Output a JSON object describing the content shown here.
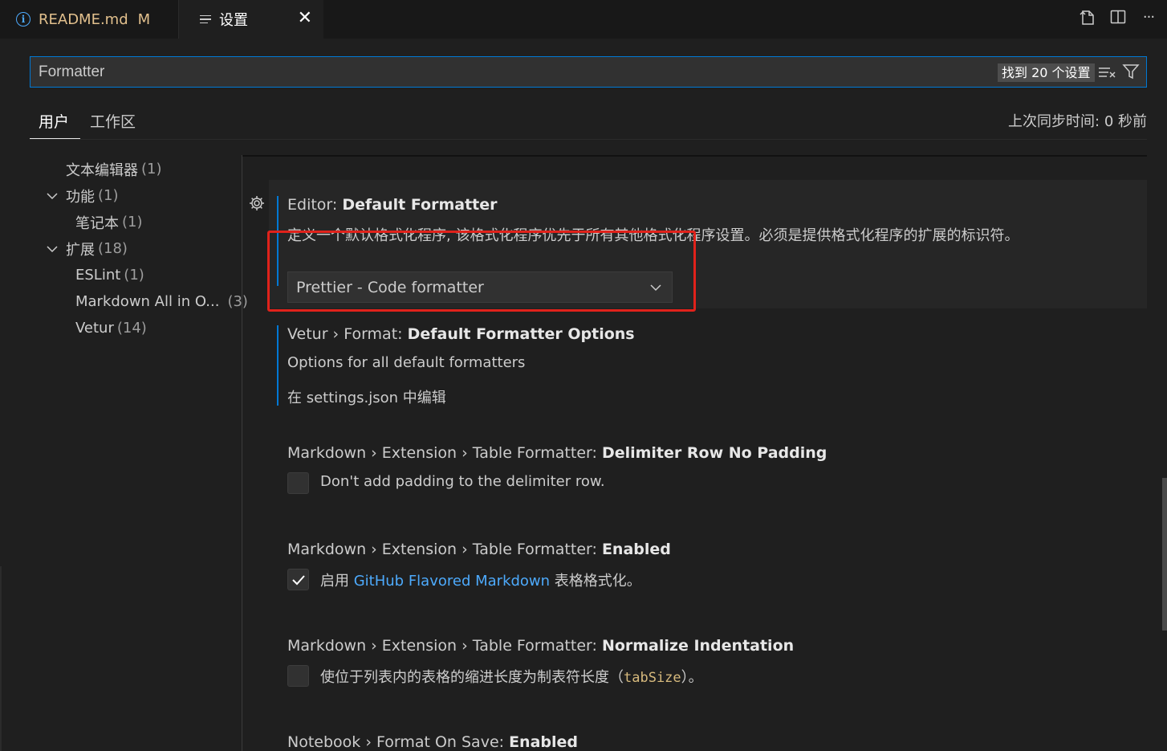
{
  "tabs": {
    "readme": {
      "label": "README.md",
      "badge": "M"
    },
    "settings": {
      "label": "设置",
      "close": "✕"
    }
  },
  "toolbar": {
    "open_json_icon": "open-settings-json-icon",
    "split_icon": "split-editor-icon",
    "more_label": "···"
  },
  "search": {
    "value": "Formatter",
    "count": "找到 20 个设置"
  },
  "scope": {
    "user": "用户",
    "workspace": "工作区",
    "sync": "上次同步时间: 0 秒前"
  },
  "toc": [
    {
      "label": "文本编辑器",
      "count": "(1)"
    },
    {
      "label": "功能",
      "count": "(1)"
    },
    {
      "label": "笔记本",
      "count": "(1)"
    },
    {
      "label": "扩展",
      "count": "(18)"
    },
    {
      "label": "ESLint",
      "count": "(1)"
    },
    {
      "label": "Markdown All in O...",
      "count": "(3)"
    },
    {
      "label": "Vetur",
      "count": "(14)"
    }
  ],
  "settings": {
    "default_formatter": {
      "category": "Editor: ",
      "name": "Default Formatter",
      "description": "定义一个默认格式化程序, 该格式化程序优先于所有其他格式化程序设置。必须是提供格式化程序的扩展的标识符。",
      "value": "Prettier - Code formatter"
    },
    "vetur_options": {
      "category": "Vetur › Format: ",
      "name": "Default Formatter Options",
      "description": "Options for all default formatters",
      "link": "在 settings.json 中编辑"
    },
    "md_delimiter": {
      "category": "Markdown › Extension › Table Formatter: ",
      "name": "Delimiter Row No Padding",
      "description": "Don't add padding to the delimiter row.",
      "checked": false
    },
    "md_enabled": {
      "category": "Markdown › Extension › Table Formatter: ",
      "name": "Enabled",
      "desc_pre": "启用 ",
      "desc_link": "GitHub Flavored Markdown",
      "desc_post": " 表格格式化。",
      "checked": true
    },
    "md_normalize": {
      "category": "Markdown › Extension › Table Formatter: ",
      "name": "Normalize Indentation",
      "desc_pre": "使位于列表内的表格的缩进长度为制表符长度（",
      "desc_code": "tabSize",
      "desc_post": "）。",
      "checked": false
    },
    "notebook_format": {
      "category": "Notebook › Format On Save: ",
      "name": "Enabled"
    }
  }
}
